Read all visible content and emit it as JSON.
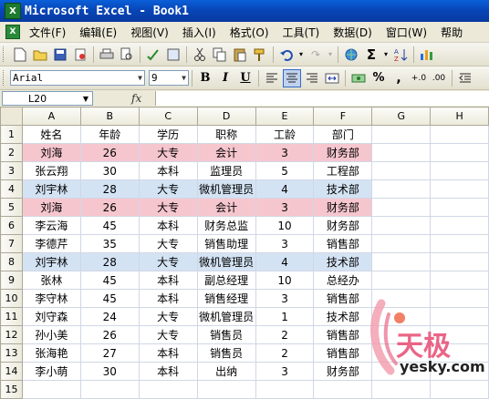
{
  "window": {
    "title": "Microsoft Excel - Book1",
    "app_icon": "X"
  },
  "menubar": {
    "doc_icon": "X",
    "items": [
      "文件(F)",
      "编辑(E)",
      "视图(V)",
      "插入(I)",
      "格式(O)",
      "工具(T)",
      "数据(D)",
      "窗口(W)",
      "帮助"
    ]
  },
  "formatting": {
    "font_name": "Arial",
    "font_size": "9",
    "bold": "B",
    "italic": "I",
    "underline": "U",
    "percent": "%"
  },
  "formula_bar": {
    "name_box": "L20",
    "fx_label": "fx",
    "content": ""
  },
  "grid": {
    "columns": [
      "A",
      "B",
      "C",
      "D",
      "E",
      "F",
      "G",
      "H"
    ],
    "rows": [
      {
        "num": "1",
        "style": "",
        "cells": [
          "姓名",
          "年龄",
          "学历",
          "职称",
          "工龄",
          "部门",
          "",
          ""
        ]
      },
      {
        "num": "2",
        "style": "pink",
        "cells": [
          "刘海",
          "26",
          "大专",
          "会计",
          "3",
          "财务部",
          "",
          ""
        ]
      },
      {
        "num": "3",
        "style": "",
        "cells": [
          "张云翔",
          "30",
          "本科",
          "监理员",
          "5",
          "工程部",
          "",
          ""
        ]
      },
      {
        "num": "4",
        "style": "blue",
        "cells": [
          "刘宇林",
          "28",
          "大专",
          "微机管理员",
          "4",
          "技术部",
          "",
          ""
        ]
      },
      {
        "num": "5",
        "style": "pink",
        "cells": [
          "刘海",
          "26",
          "大专",
          "会计",
          "3",
          "财务部",
          "",
          ""
        ]
      },
      {
        "num": "6",
        "style": "",
        "cells": [
          "李云海",
          "45",
          "本科",
          "财务总监",
          "10",
          "财务部",
          "",
          ""
        ]
      },
      {
        "num": "7",
        "style": "",
        "cells": [
          "李德芹",
          "35",
          "大专",
          "销售助理",
          "3",
          "销售部",
          "",
          ""
        ]
      },
      {
        "num": "8",
        "style": "blue",
        "cells": [
          "刘宇林",
          "28",
          "大专",
          "微机管理员",
          "4",
          "技术部",
          "",
          ""
        ]
      },
      {
        "num": "9",
        "style": "",
        "cells": [
          "张林",
          "45",
          "本科",
          "副总经理",
          "10",
          "总经办",
          "",
          ""
        ]
      },
      {
        "num": "10",
        "style": "",
        "cells": [
          "李守林",
          "45",
          "本科",
          "销售经理",
          "3",
          "销售部",
          "",
          ""
        ]
      },
      {
        "num": "11",
        "style": "",
        "cells": [
          "刘守森",
          "24",
          "大专",
          "微机管理员",
          "1",
          "技术部",
          "",
          ""
        ]
      },
      {
        "num": "12",
        "style": "",
        "cells": [
          "孙小美",
          "26",
          "大专",
          "销售员",
          "2",
          "销售部",
          "",
          ""
        ]
      },
      {
        "num": "13",
        "style": "",
        "cells": [
          "张海艳",
          "27",
          "本科",
          "销售员",
          "2",
          "销售部",
          "",
          ""
        ]
      },
      {
        "num": "14",
        "style": "",
        "cells": [
          "李小萌",
          "30",
          "本科",
          "出纳",
          "3",
          "财务部",
          "",
          ""
        ]
      },
      {
        "num": "15",
        "style": "",
        "cells": [
          "",
          "",
          "",
          "",
          "",
          "",
          "",
          ""
        ]
      }
    ]
  },
  "watermark": {
    "brand_cn": "天极",
    "brand_url": "yesky.com"
  },
  "colors": {
    "duplicate_pink": "#f6c6cf",
    "duplicate_blue": "#d4e3f4",
    "titlebar": "#0846b8"
  }
}
